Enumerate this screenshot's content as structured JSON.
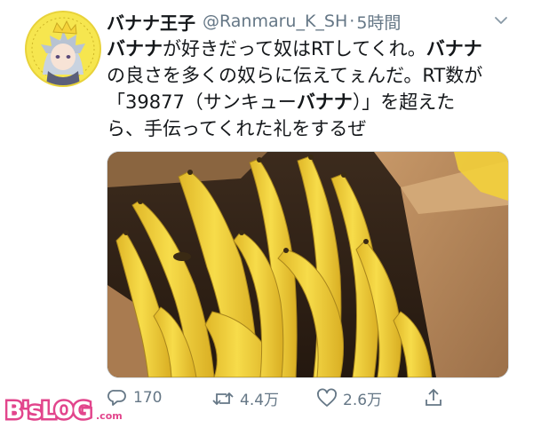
{
  "header": {
    "display_name": "バナナ王子",
    "handle": "@Ranmaru_K_SH",
    "separator": "·",
    "time": "5時間"
  },
  "tweet": {
    "lines": [
      {
        "parts": [
          {
            "t": "バナナ",
            "b": true
          },
          {
            "t": "が好きだって奴はRTしてくれ。",
            "b": false
          },
          {
            "t": "バナナ",
            "b": true
          }
        ]
      },
      {
        "parts": [
          {
            "t": "の良さを多くの奴らに伝えてぇんだ。RT数が",
            "b": false
          }
        ]
      },
      {
        "parts": [
          {
            "t": "「39877（サンキュー",
            "b": false
          },
          {
            "t": "バナナ",
            "b": true
          },
          {
            "t": "）」を超えた",
            "b": false
          }
        ]
      },
      {
        "parts": [
          {
            "t": "ら、手伝ってくれた礼をするぜ",
            "b": false
          }
        ]
      }
    ]
  },
  "photo": {
    "subject": "bananas in a cardboard box"
  },
  "actions": {
    "reply": {
      "icon": "reply-icon",
      "count": "170"
    },
    "retweet": {
      "icon": "retweet-icon",
      "count": "4.4万"
    },
    "like": {
      "icon": "heart-icon",
      "count": "2.6万"
    },
    "share": {
      "icon": "share-icon"
    }
  },
  "watermark": {
    "brand": "B'sLOG.com"
  },
  "colors": {
    "muted": "#657786",
    "text": "#14171a",
    "banana": "#f2d23a",
    "box": "#b9895a",
    "logo_pink": "#e2458c"
  }
}
